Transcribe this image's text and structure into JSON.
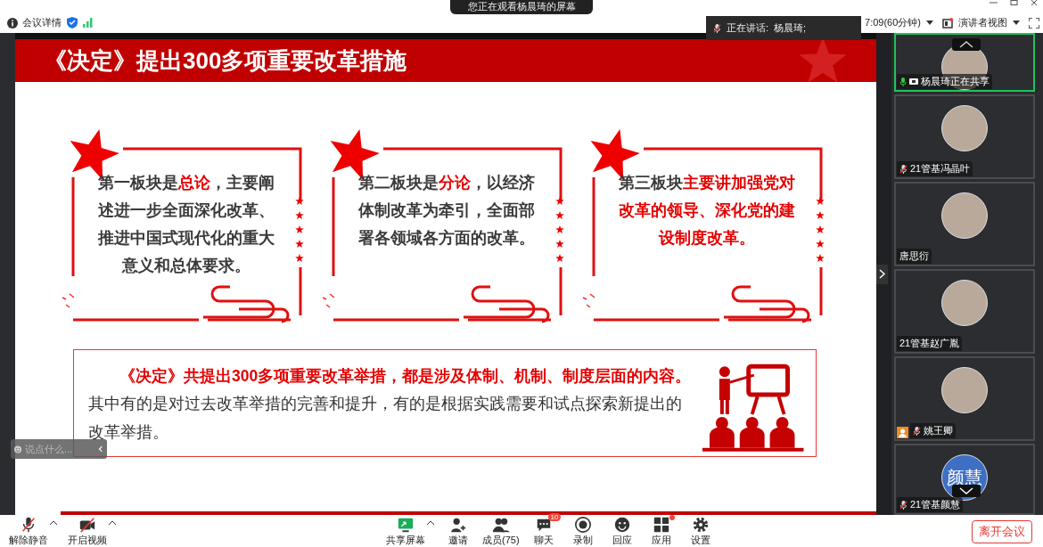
{
  "top_bar": {
    "meeting_info": "会议详情",
    "viewing_banner": "您正在观看杨晨琦的屏幕",
    "timer": "7:09(60分钟)",
    "view_mode": "演讲者视图"
  },
  "speaking": {
    "label": "正在讲话:",
    "name": "杨晨琦;"
  },
  "slide": {
    "title": "《决定》提出300多项重要改革措施",
    "cards": [
      {
        "text": "第一板块是**总论**，主要阐述进一步全面深化改革、推进中国式现代化的重大意义和总体要求。"
      },
      {
        "text": "第二板块是**分论**，以经济体制改革为牵引，全面部署各领域各方面的改革。"
      },
      {
        "text": "第三板块**主要讲加强党对改革的领导、深化党的建设制度改革。**"
      }
    ],
    "summary": {
      "highlight": "《决定》共提出300多项重要改革举措，都是涉及体制、机制、制度层面的内容。",
      "body": "其中有的是对过去改革举措的完善和提升，有的是根据实践需要和试点探索新提出的改革举措。"
    }
  },
  "chat_input": {
    "placeholder": "说点什么..."
  },
  "participants": [
    {
      "name": "杨晨琦正在共享",
      "kind": "mic-on",
      "speaking": true,
      "sharing": true,
      "host_icon": false,
      "avatar": {
        "kind": "photo"
      }
    },
    {
      "name": "21管基冯晶叶",
      "kind": "mic-muted",
      "speaking": false,
      "sharing": false,
      "host_icon": false,
      "avatar": {
        "kind": "photo"
      }
    },
    {
      "name": "唐思衍",
      "kind": "no-mic",
      "speaking": false,
      "sharing": false,
      "host_icon": false,
      "avatar": {
        "kind": "photo"
      }
    },
    {
      "name": "21管基赵广胤",
      "kind": "no-mic",
      "speaking": false,
      "sharing": false,
      "host_icon": false,
      "avatar": {
        "kind": "photo"
      }
    },
    {
      "name": "姚王卿",
      "kind": "mic-muted",
      "speaking": false,
      "sharing": false,
      "host_icon": true,
      "avatar": {
        "kind": "photo"
      }
    },
    {
      "name": "21管基颜慧",
      "kind": "mic-muted",
      "speaking": false,
      "sharing": false,
      "host_icon": false,
      "avatar": {
        "kind": "initials",
        "text": "颜慧"
      }
    }
  ],
  "toolbar": [
    {
      "label": "解除静音",
      "caret": true,
      "dot": false
    },
    {
      "label": "开启视频",
      "caret": true,
      "dot": false
    },
    {
      "label": "共享屏幕",
      "caret": true,
      "dot": false
    },
    {
      "label": "邀请",
      "caret": false,
      "dot": false
    },
    {
      "label": "成员(75)",
      "caret": false,
      "dot": false
    },
    {
      "label": "聊天",
      "caret": false,
      "dot": false,
      "badge": "10"
    },
    {
      "label": "录制",
      "caret": false,
      "dot": false
    },
    {
      "label": "回应",
      "caret": false,
      "dot": false
    },
    {
      "label": "应用",
      "caret": false,
      "dot": true
    },
    {
      "label": "设置",
      "caret": false,
      "dot": false
    }
  ],
  "leave_button": "离开会议"
}
